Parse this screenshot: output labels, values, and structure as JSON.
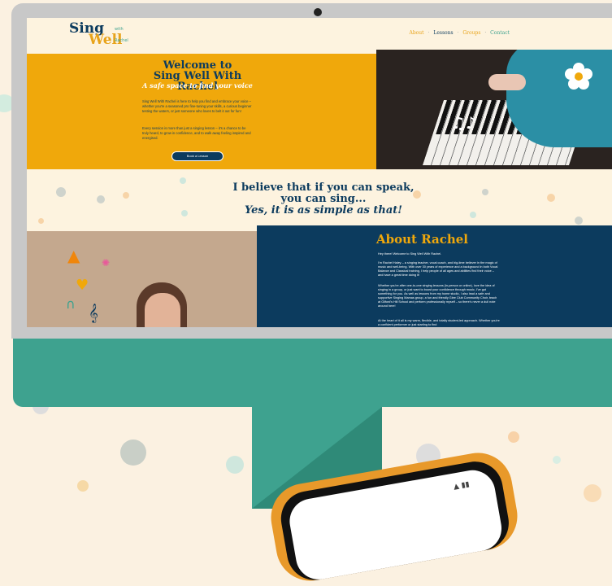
{
  "site": {
    "logo_line1": "Sing",
    "logo_line2": "Well",
    "logo_tagline": "with Rachel",
    "nav": [
      "About",
      "Lessons",
      "Groups",
      "Contact"
    ],
    "nav_separator": "·"
  },
  "hero": {
    "title_line1": "Welcome to",
    "title_line2": "Sing Well With Rachel",
    "subtitle": "A safe space to find your voice",
    "paragraph1": "Sing Well With Rachel is here to help you find and embrace your voice – whether you're a seasoned pro fine-tuning your skills, a curious beginner testing the waters, or just someone who loves to belt it out for fun!",
    "paragraph2": "Every session is more than just a singing lesson – it's a chance to be truly heard, to grow in confidence, and to walk away feeling inspired and energised.",
    "button": "Book a Lesson"
  },
  "quote": {
    "line1": "I believe that if you can speak,",
    "line2": "you can sing...",
    "line3": "Yes, it is as simple as that!"
  },
  "about": {
    "title": "About Rachel",
    "greeting": "Hey there! Welcome to Sing Well With Rachel.",
    "paragraph1": "I'm Rachel Haley – a singing teacher, vocal coach, and big-time believer in the magic of music and well-being. With over 30 years of experience and a background in both Vocal Balance and Classical training, I help people of all ages and abilities find their voice – and have a great time doing it!",
    "paragraph2": "Whether you're after one-to-one singing lessons (in-person or online), love the idea of singing in a group, or just want to boost your confidence through music, I've got something for you. As well as lessons from my home studio, I also lead a safe and supportive Singing Mamas group, a fun and friendly Glee Club Community Choir, teach at Gilford's Hill School and perform professionally myself – so there's never a dull note around here!",
    "paragraph3": "At the heart of it all is my warm, flexible, and totally student-led approach. Whether you're a confident performer or just starting to find"
  },
  "colors": {
    "navy": "#0c3b5e",
    "mustard": "#f0a80b",
    "teal": "#3ea28f",
    "cream": "#fdf3df",
    "orange": "#e8992a"
  },
  "icons": [
    "music-notes-icon",
    "flower-icon",
    "cake-icon",
    "coffee-cup-icon",
    "rainbow-icon",
    "treble-clef-icon",
    "sparkle-icon",
    "camera-dot-icon",
    "phone-status-icon"
  ]
}
